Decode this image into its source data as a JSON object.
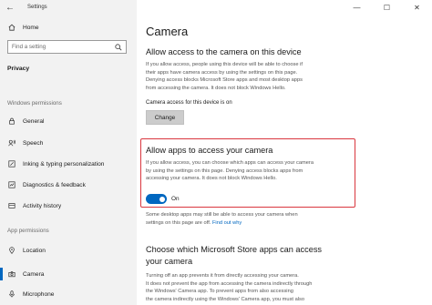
{
  "window": {
    "title": "Settings"
  },
  "sidebar": {
    "home_label": "Home",
    "search_placeholder": "Find a setting",
    "category": "Privacy",
    "sections": {
      "windows_permissions": "Windows permissions",
      "app_permissions": "App permissions"
    },
    "windows_items": [
      {
        "label": "General",
        "icon": "lock-icon"
      },
      {
        "label": "Speech",
        "icon": "speech-icon"
      },
      {
        "label": "Inking & typing personalization",
        "icon": "inking-icon"
      },
      {
        "label": "Diagnostics & feedback",
        "icon": "diagnostics-icon"
      },
      {
        "label": "Activity history",
        "icon": "activity-icon"
      }
    ],
    "app_items": [
      {
        "label": "Location",
        "icon": "location-icon"
      },
      {
        "label": "Camera",
        "icon": "camera-icon",
        "selected": true
      },
      {
        "label": "Microphone",
        "icon": "microphone-icon"
      }
    ]
  },
  "main": {
    "title": "Camera",
    "device_section": {
      "heading": "Allow access to the camera on this device",
      "desc_lines": [
        "If you allow access, people using this device will be able to choose if",
        "their apps have camera access by using the settings on this page.",
        "Denying access blocks Microsoft Store apps and most desktop apps",
        "from accessing the camera. It does not block Windows Hello."
      ],
      "status": "Camera access for this device is on",
      "button": "Change"
    },
    "apps_section": {
      "heading": "Allow apps to access your camera",
      "desc_lines": [
        "If you allow access, you can choose which apps can access your camera",
        "by using the settings on this page. Denying access blocks apps from",
        "accessing your camera. It does not block Windows Hello."
      ],
      "toggle_state": "On",
      "note_lines": [
        "Some desktop apps may still be able to access your camera when",
        "settings on this page are off."
      ],
      "note_link": "Find out why"
    },
    "store_section": {
      "heading_lines": [
        "Choose which Microsoft Store apps can access",
        "your camera"
      ],
      "desc_lines": [
        "Turning off an app prevents it from directly accessing your camera.",
        "It does not prevent the app from accessing the camera indirectly through",
        "the Windows' Camera app. To prevent apps from also accessing",
        "the camera indirectly using the Windows' Camera app, you must also"
      ]
    }
  },
  "colors": {
    "accent": "#0067c0",
    "highlight": "#d9363e",
    "sidebar_bg": "#f2f2f2"
  }
}
